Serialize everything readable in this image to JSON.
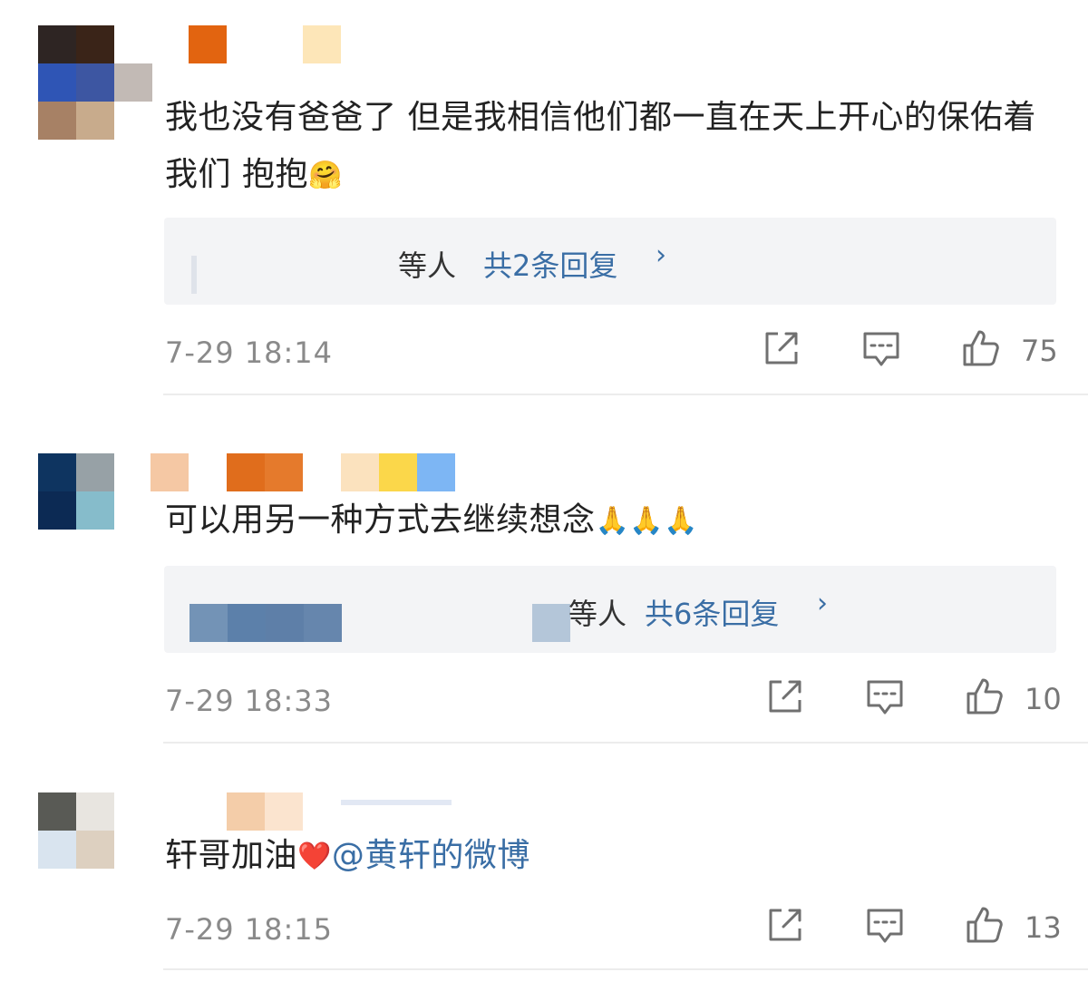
{
  "comments": [
    {
      "text": "我也没有爸爸了 但是我相信他们都一直在天上开心的保佑着我们 抱抱",
      "emoji": "🤗",
      "reply_suffix": "等人",
      "reply_count": "共2条回复",
      "reply_chevron": "›",
      "time": "7-29 18:14",
      "likes": "75"
    },
    {
      "text": "可以用另一种方式去继续想念",
      "emoji": "🙏🙏🙏",
      "reply_suffix": "等人",
      "reply_count": "共6条回复",
      "reply_chevron": "›",
      "time": "7-29 18:33",
      "likes": "10"
    },
    {
      "text": "轩哥加油",
      "emoji": "❤️",
      "mention": "@黄轩的微博",
      "time": "7-29 18:15",
      "likes": "13"
    }
  ],
  "icons": {
    "share": "share-icon",
    "comment": "comment-icon",
    "like": "thumbs-up-icon"
  },
  "colors": {
    "link": "#3a6ea5",
    "meta": "#8a8a8a",
    "reply_bg": "#f3f4f6"
  }
}
